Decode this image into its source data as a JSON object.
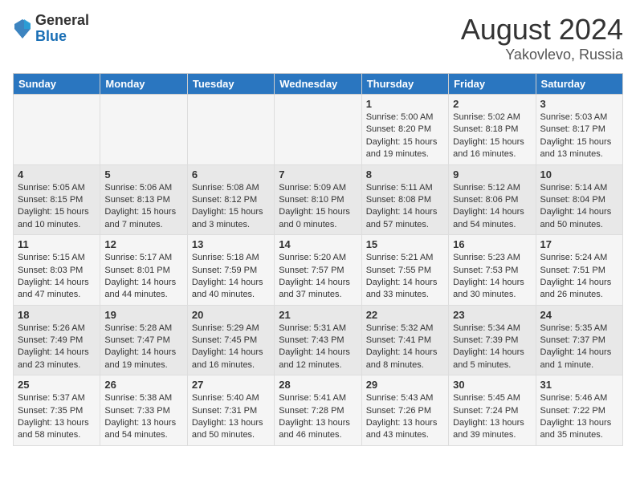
{
  "header": {
    "logo_general": "General",
    "logo_blue": "Blue",
    "month": "August 2024",
    "location": "Yakovlevo, Russia"
  },
  "days_of_week": [
    "Sunday",
    "Monday",
    "Tuesday",
    "Wednesday",
    "Thursday",
    "Friday",
    "Saturday"
  ],
  "weeks": [
    [
      {
        "day": "",
        "info": ""
      },
      {
        "day": "",
        "info": ""
      },
      {
        "day": "",
        "info": ""
      },
      {
        "day": "",
        "info": ""
      },
      {
        "day": "1",
        "info": "Sunrise: 5:00 AM\nSunset: 8:20 PM\nDaylight: 15 hours\nand 19 minutes."
      },
      {
        "day": "2",
        "info": "Sunrise: 5:02 AM\nSunset: 8:18 PM\nDaylight: 15 hours\nand 16 minutes."
      },
      {
        "day": "3",
        "info": "Sunrise: 5:03 AM\nSunset: 8:17 PM\nDaylight: 15 hours\nand 13 minutes."
      }
    ],
    [
      {
        "day": "4",
        "info": "Sunrise: 5:05 AM\nSunset: 8:15 PM\nDaylight: 15 hours\nand 10 minutes."
      },
      {
        "day": "5",
        "info": "Sunrise: 5:06 AM\nSunset: 8:13 PM\nDaylight: 15 hours\nand 7 minutes."
      },
      {
        "day": "6",
        "info": "Sunrise: 5:08 AM\nSunset: 8:12 PM\nDaylight: 15 hours\nand 3 minutes."
      },
      {
        "day": "7",
        "info": "Sunrise: 5:09 AM\nSunset: 8:10 PM\nDaylight: 15 hours\nand 0 minutes."
      },
      {
        "day": "8",
        "info": "Sunrise: 5:11 AM\nSunset: 8:08 PM\nDaylight: 14 hours\nand 57 minutes."
      },
      {
        "day": "9",
        "info": "Sunrise: 5:12 AM\nSunset: 8:06 PM\nDaylight: 14 hours\nand 54 minutes."
      },
      {
        "day": "10",
        "info": "Sunrise: 5:14 AM\nSunset: 8:04 PM\nDaylight: 14 hours\nand 50 minutes."
      }
    ],
    [
      {
        "day": "11",
        "info": "Sunrise: 5:15 AM\nSunset: 8:03 PM\nDaylight: 14 hours\nand 47 minutes."
      },
      {
        "day": "12",
        "info": "Sunrise: 5:17 AM\nSunset: 8:01 PM\nDaylight: 14 hours\nand 44 minutes."
      },
      {
        "day": "13",
        "info": "Sunrise: 5:18 AM\nSunset: 7:59 PM\nDaylight: 14 hours\nand 40 minutes."
      },
      {
        "day": "14",
        "info": "Sunrise: 5:20 AM\nSunset: 7:57 PM\nDaylight: 14 hours\nand 37 minutes."
      },
      {
        "day": "15",
        "info": "Sunrise: 5:21 AM\nSunset: 7:55 PM\nDaylight: 14 hours\nand 33 minutes."
      },
      {
        "day": "16",
        "info": "Sunrise: 5:23 AM\nSunset: 7:53 PM\nDaylight: 14 hours\nand 30 minutes."
      },
      {
        "day": "17",
        "info": "Sunrise: 5:24 AM\nSunset: 7:51 PM\nDaylight: 14 hours\nand 26 minutes."
      }
    ],
    [
      {
        "day": "18",
        "info": "Sunrise: 5:26 AM\nSunset: 7:49 PM\nDaylight: 14 hours\nand 23 minutes."
      },
      {
        "day": "19",
        "info": "Sunrise: 5:28 AM\nSunset: 7:47 PM\nDaylight: 14 hours\nand 19 minutes."
      },
      {
        "day": "20",
        "info": "Sunrise: 5:29 AM\nSunset: 7:45 PM\nDaylight: 14 hours\nand 16 minutes."
      },
      {
        "day": "21",
        "info": "Sunrise: 5:31 AM\nSunset: 7:43 PM\nDaylight: 14 hours\nand 12 minutes."
      },
      {
        "day": "22",
        "info": "Sunrise: 5:32 AM\nSunset: 7:41 PM\nDaylight: 14 hours\nand 8 minutes."
      },
      {
        "day": "23",
        "info": "Sunrise: 5:34 AM\nSunset: 7:39 PM\nDaylight: 14 hours\nand 5 minutes."
      },
      {
        "day": "24",
        "info": "Sunrise: 5:35 AM\nSunset: 7:37 PM\nDaylight: 14 hours\nand 1 minute."
      }
    ],
    [
      {
        "day": "25",
        "info": "Sunrise: 5:37 AM\nSunset: 7:35 PM\nDaylight: 13 hours\nand 58 minutes."
      },
      {
        "day": "26",
        "info": "Sunrise: 5:38 AM\nSunset: 7:33 PM\nDaylight: 13 hours\nand 54 minutes."
      },
      {
        "day": "27",
        "info": "Sunrise: 5:40 AM\nSunset: 7:31 PM\nDaylight: 13 hours\nand 50 minutes."
      },
      {
        "day": "28",
        "info": "Sunrise: 5:41 AM\nSunset: 7:28 PM\nDaylight: 13 hours\nand 46 minutes."
      },
      {
        "day": "29",
        "info": "Sunrise: 5:43 AM\nSunset: 7:26 PM\nDaylight: 13 hours\nand 43 minutes."
      },
      {
        "day": "30",
        "info": "Sunrise: 5:45 AM\nSunset: 7:24 PM\nDaylight: 13 hours\nand 39 minutes."
      },
      {
        "day": "31",
        "info": "Sunrise: 5:46 AM\nSunset: 7:22 PM\nDaylight: 13 hours\nand 35 minutes."
      }
    ]
  ]
}
